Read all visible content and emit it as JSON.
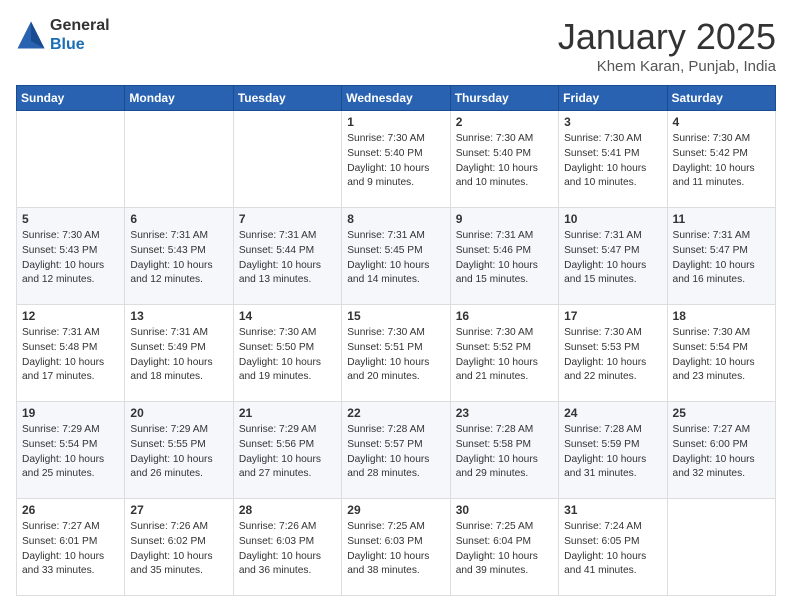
{
  "logo": {
    "general": "General",
    "blue": "Blue"
  },
  "header": {
    "month": "January 2025",
    "location": "Khem Karan, Punjab, India"
  },
  "weekdays": [
    "Sunday",
    "Monday",
    "Tuesday",
    "Wednesday",
    "Thursday",
    "Friday",
    "Saturday"
  ],
  "weeks": [
    [
      {
        "day": "",
        "info": ""
      },
      {
        "day": "",
        "info": ""
      },
      {
        "day": "",
        "info": ""
      },
      {
        "day": "1",
        "info": "Sunrise: 7:30 AM\nSunset: 5:40 PM\nDaylight: 10 hours\nand 9 minutes."
      },
      {
        "day": "2",
        "info": "Sunrise: 7:30 AM\nSunset: 5:40 PM\nDaylight: 10 hours\nand 10 minutes."
      },
      {
        "day": "3",
        "info": "Sunrise: 7:30 AM\nSunset: 5:41 PM\nDaylight: 10 hours\nand 10 minutes."
      },
      {
        "day": "4",
        "info": "Sunrise: 7:30 AM\nSunset: 5:42 PM\nDaylight: 10 hours\nand 11 minutes."
      }
    ],
    [
      {
        "day": "5",
        "info": "Sunrise: 7:30 AM\nSunset: 5:43 PM\nDaylight: 10 hours\nand 12 minutes."
      },
      {
        "day": "6",
        "info": "Sunrise: 7:31 AM\nSunset: 5:43 PM\nDaylight: 10 hours\nand 12 minutes."
      },
      {
        "day": "7",
        "info": "Sunrise: 7:31 AM\nSunset: 5:44 PM\nDaylight: 10 hours\nand 13 minutes."
      },
      {
        "day": "8",
        "info": "Sunrise: 7:31 AM\nSunset: 5:45 PM\nDaylight: 10 hours\nand 14 minutes."
      },
      {
        "day": "9",
        "info": "Sunrise: 7:31 AM\nSunset: 5:46 PM\nDaylight: 10 hours\nand 15 minutes."
      },
      {
        "day": "10",
        "info": "Sunrise: 7:31 AM\nSunset: 5:47 PM\nDaylight: 10 hours\nand 15 minutes."
      },
      {
        "day": "11",
        "info": "Sunrise: 7:31 AM\nSunset: 5:47 PM\nDaylight: 10 hours\nand 16 minutes."
      }
    ],
    [
      {
        "day": "12",
        "info": "Sunrise: 7:31 AM\nSunset: 5:48 PM\nDaylight: 10 hours\nand 17 minutes."
      },
      {
        "day": "13",
        "info": "Sunrise: 7:31 AM\nSunset: 5:49 PM\nDaylight: 10 hours\nand 18 minutes."
      },
      {
        "day": "14",
        "info": "Sunrise: 7:30 AM\nSunset: 5:50 PM\nDaylight: 10 hours\nand 19 minutes."
      },
      {
        "day": "15",
        "info": "Sunrise: 7:30 AM\nSunset: 5:51 PM\nDaylight: 10 hours\nand 20 minutes."
      },
      {
        "day": "16",
        "info": "Sunrise: 7:30 AM\nSunset: 5:52 PM\nDaylight: 10 hours\nand 21 minutes."
      },
      {
        "day": "17",
        "info": "Sunrise: 7:30 AM\nSunset: 5:53 PM\nDaylight: 10 hours\nand 22 minutes."
      },
      {
        "day": "18",
        "info": "Sunrise: 7:30 AM\nSunset: 5:54 PM\nDaylight: 10 hours\nand 23 minutes."
      }
    ],
    [
      {
        "day": "19",
        "info": "Sunrise: 7:29 AM\nSunset: 5:54 PM\nDaylight: 10 hours\nand 25 minutes."
      },
      {
        "day": "20",
        "info": "Sunrise: 7:29 AM\nSunset: 5:55 PM\nDaylight: 10 hours\nand 26 minutes."
      },
      {
        "day": "21",
        "info": "Sunrise: 7:29 AM\nSunset: 5:56 PM\nDaylight: 10 hours\nand 27 minutes."
      },
      {
        "day": "22",
        "info": "Sunrise: 7:28 AM\nSunset: 5:57 PM\nDaylight: 10 hours\nand 28 minutes."
      },
      {
        "day": "23",
        "info": "Sunrise: 7:28 AM\nSunset: 5:58 PM\nDaylight: 10 hours\nand 29 minutes."
      },
      {
        "day": "24",
        "info": "Sunrise: 7:28 AM\nSunset: 5:59 PM\nDaylight: 10 hours\nand 31 minutes."
      },
      {
        "day": "25",
        "info": "Sunrise: 7:27 AM\nSunset: 6:00 PM\nDaylight: 10 hours\nand 32 minutes."
      }
    ],
    [
      {
        "day": "26",
        "info": "Sunrise: 7:27 AM\nSunset: 6:01 PM\nDaylight: 10 hours\nand 33 minutes."
      },
      {
        "day": "27",
        "info": "Sunrise: 7:26 AM\nSunset: 6:02 PM\nDaylight: 10 hours\nand 35 minutes."
      },
      {
        "day": "28",
        "info": "Sunrise: 7:26 AM\nSunset: 6:03 PM\nDaylight: 10 hours\nand 36 minutes."
      },
      {
        "day": "29",
        "info": "Sunrise: 7:25 AM\nSunset: 6:03 PM\nDaylight: 10 hours\nand 38 minutes."
      },
      {
        "day": "30",
        "info": "Sunrise: 7:25 AM\nSunset: 6:04 PM\nDaylight: 10 hours\nand 39 minutes."
      },
      {
        "day": "31",
        "info": "Sunrise: 7:24 AM\nSunset: 6:05 PM\nDaylight: 10 hours\nand 41 minutes."
      },
      {
        "day": "",
        "info": ""
      }
    ]
  ]
}
